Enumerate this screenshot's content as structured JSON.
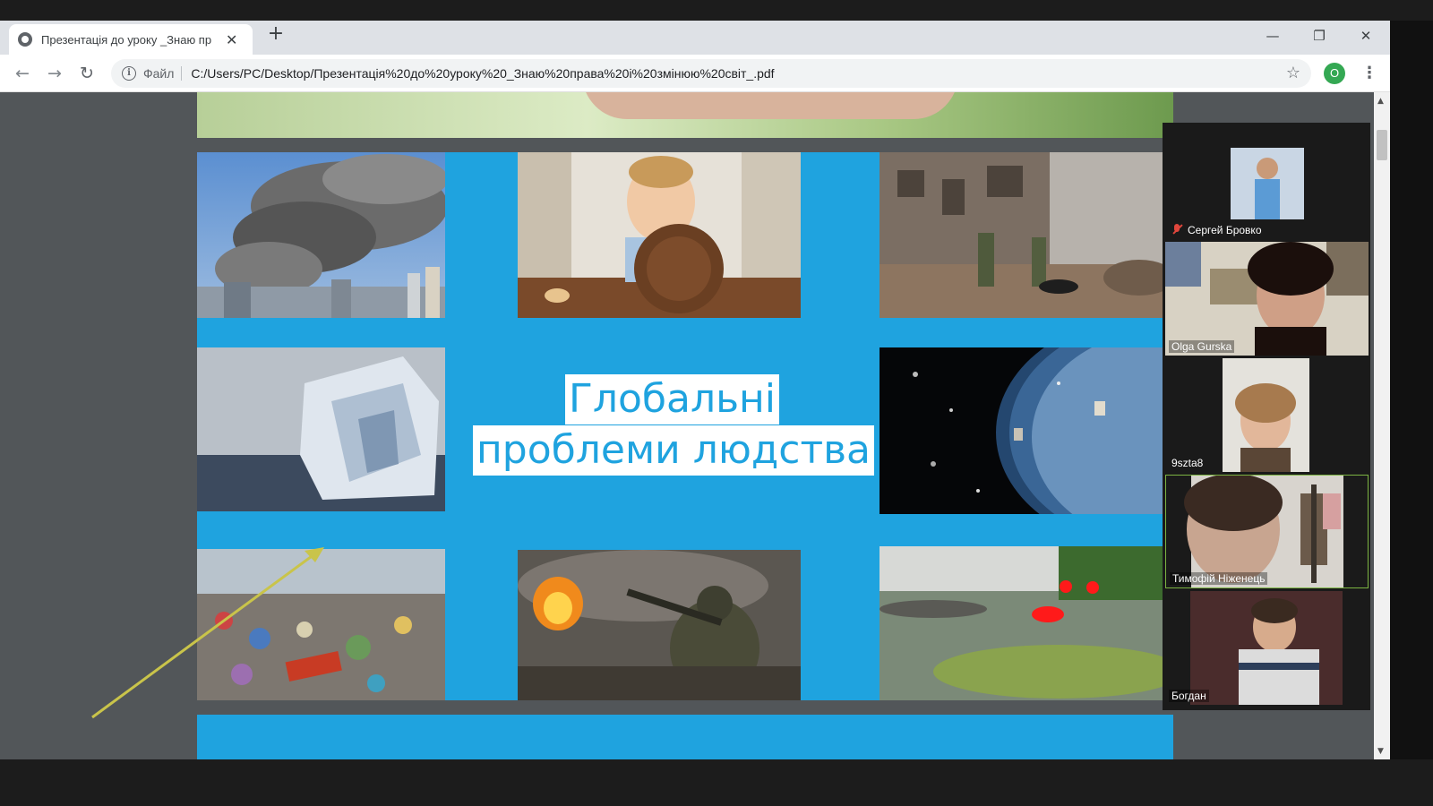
{
  "browser": {
    "tab_title": "Презентація до уроку _Знаю пр",
    "new_tab_glyph": "+",
    "close_tab_glyph": "✕",
    "window_controls": {
      "minimize": "—",
      "restore": "❐",
      "close": "✕"
    },
    "nav": {
      "back": "←",
      "forward": "→",
      "reload": "↻"
    },
    "omnibox": {
      "info_icon": "i",
      "scheme_label": "Файл",
      "url": "C:/Users/PC/Desktop/Презентація%20до%20уроку%20_Знаю%20права%20і%20змінюю%20світ_.pdf"
    },
    "bookmark_icon": "☆",
    "profile_initial": "O",
    "menu_glyph": "⋮"
  },
  "slide": {
    "title_line1": "Глобальні",
    "title_line2": "проблеми людства",
    "photos": [
      {
        "name": "photo-smoke-city"
      },
      {
        "name": "photo-child-empty-plate"
      },
      {
        "name": "photo-soldiers-ruins"
      },
      {
        "name": "photo-melting-iceberg"
      },
      {
        "name": "photo-space-debris"
      },
      {
        "name": "photo-landfill"
      },
      {
        "name": "photo-soldier-fire"
      },
      {
        "name": "photo-polluted-water"
      }
    ]
  },
  "participants": [
    {
      "name": "Сергей Бровко",
      "muted": true
    },
    {
      "name": "Olga Gurska",
      "muted": false
    },
    {
      "name": "9szta8",
      "muted": false
    },
    {
      "name": "Тимофій Ніженець",
      "muted": false,
      "active": true
    },
    {
      "name": "Богдан",
      "muted": false
    }
  ],
  "scrollbar": {
    "up": "▲",
    "down": "▼"
  },
  "colors": {
    "slide_blue": "#1fa3df",
    "annotation_arrow": "#c9c44a",
    "annotation_red": "#ff1a1a",
    "active_speaker": "#7cb342"
  }
}
